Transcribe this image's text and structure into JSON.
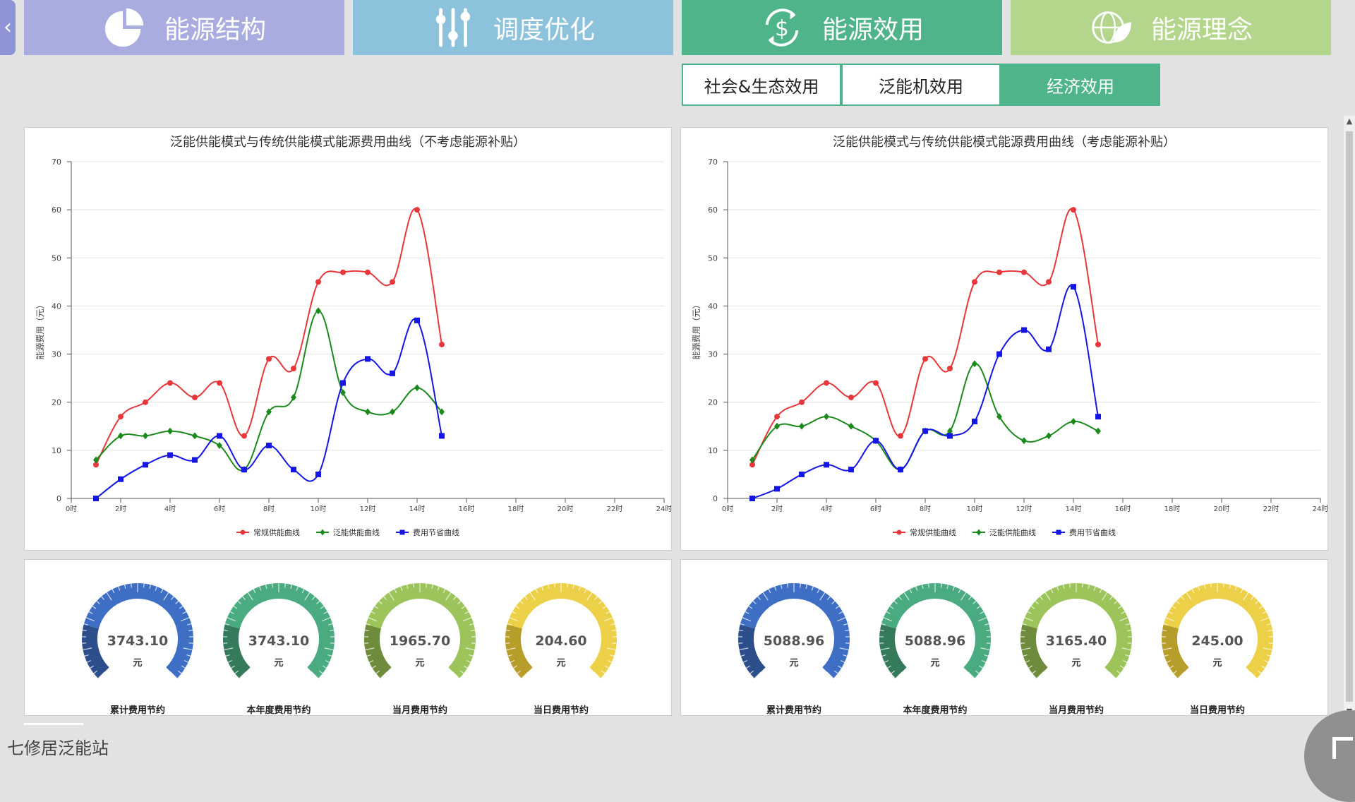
{
  "nav": {
    "back_icon": "chevron-left-icon",
    "tabs": [
      {
        "label": "能源结构",
        "icon": "pie-chart-icon",
        "color": "#a9acdf"
      },
      {
        "label": "调度优化",
        "icon": "sliders-icon",
        "color": "#8cc2db"
      },
      {
        "label": "能源效用",
        "icon": "dollar-cycle-icon",
        "color": "#4fb489",
        "active": true
      },
      {
        "label": "能源理念",
        "icon": "globe-leaf-icon",
        "color": "#b3d68c"
      }
    ]
  },
  "subtabs": [
    {
      "label": "社会&生态效用",
      "active": false
    },
    {
      "label": "泛能机效用",
      "active": false
    },
    {
      "label": "经济效用",
      "active": true
    }
  ],
  "charts": {
    "left_title": "泛能供能模式与传统供能模式能源费用曲线（不考虑能源补贴）",
    "right_title": "泛能供能模式与传统供能模式能源费用曲线（考虑能源补贴）",
    "ylabel": "能源费用（元）",
    "legend": [
      "常规供能曲线",
      "泛能供能曲线",
      "费用节省曲线"
    ]
  },
  "chart_data": [
    {
      "type": "line",
      "title": "泛能供能模式与传统供能模式能源费用曲线（不考虑能源补贴）",
      "ylabel": "能源费用（元）",
      "ylim": [
        0,
        70
      ],
      "yticks": [
        0,
        10,
        20,
        30,
        40,
        50,
        60,
        70
      ],
      "xlim": [
        0,
        24
      ],
      "xticks": [
        "0时",
        "2时",
        "4时",
        "6时",
        "8时",
        "10时",
        "12时",
        "14时",
        "16时",
        "18时",
        "20时",
        "22时",
        "24时"
      ],
      "x": [
        1,
        2,
        3,
        4,
        5,
        6,
        7,
        8,
        9,
        10,
        11,
        12,
        13,
        14,
        15
      ],
      "grid": true,
      "legend_position": "bottom",
      "series": [
        {
          "name": "常规供能曲线",
          "color": "#e8373a",
          "marker": "circle",
          "values": [
            7,
            17,
            20,
            24,
            21,
            24,
            13,
            29,
            27,
            45,
            47,
            47,
            45,
            60,
            32
          ]
        },
        {
          "name": "泛能供能曲线",
          "color": "#1a8a1a",
          "marker": "diamond",
          "values": [
            8,
            13,
            13,
            14,
            13,
            11,
            6,
            18,
            21,
            39,
            22,
            18,
            18,
            23,
            18
          ]
        },
        {
          "name": "费用节省曲线",
          "color": "#1515e6",
          "marker": "square",
          "values": [
            0,
            4,
            7,
            9,
            8,
            13,
            6,
            11,
            6,
            5,
            24,
            29,
            26,
            37,
            13
          ]
        }
      ]
    },
    {
      "type": "line",
      "title": "泛能供能模式与传统供能模式能源费用曲线（考虑能源补贴）",
      "ylabel": "能源费用（元）",
      "ylim": [
        0,
        70
      ],
      "yticks": [
        0,
        10,
        20,
        30,
        40,
        50,
        60,
        70
      ],
      "xlim": [
        0,
        24
      ],
      "xticks": [
        "0时",
        "2时",
        "4时",
        "6时",
        "8时",
        "10时",
        "12时",
        "14时",
        "16时",
        "18时",
        "20时",
        "22时",
        "24时"
      ],
      "x": [
        1,
        2,
        3,
        4,
        5,
        6,
        7,
        8,
        9,
        10,
        11,
        12,
        13,
        14,
        15
      ],
      "grid": true,
      "legend_position": "bottom",
      "series": [
        {
          "name": "常规供能曲线",
          "color": "#e8373a",
          "marker": "circle",
          "values": [
            7,
            17,
            20,
            24,
            21,
            24,
            13,
            29,
            27,
            45,
            47,
            47,
            45,
            60,
            32
          ]
        },
        {
          "name": "泛能供能曲线",
          "color": "#1a8a1a",
          "marker": "diamond",
          "values": [
            8,
            15,
            15,
            17,
            15,
            12,
            6,
            14,
            14,
            28,
            17,
            12,
            13,
            16,
            14
          ]
        },
        {
          "name": "费用节省曲线",
          "color": "#1515e6",
          "marker": "square",
          "values": [
            0,
            2,
            5,
            7,
            6,
            12,
            6,
            14,
            13,
            16,
            30,
            35,
            31,
            44,
            17
          ]
        }
      ]
    }
  ],
  "gauges": {
    "unit": "元",
    "left": [
      {
        "value": "3743.10",
        "label": "累计费用节约",
        "color": "#3e6fc4",
        "dark": "#2c4f8c"
      },
      {
        "value": "3743.10",
        "label": "本年度费用节约",
        "color": "#4aab80",
        "dark": "#357a5b"
      },
      {
        "value": "1965.70",
        "label": "当月费用节约",
        "color": "#9cc45a",
        "dark": "#6f8c3d"
      },
      {
        "value": "204.60",
        "label": "当日费用节约",
        "color": "#ecd048",
        "dark": "#b79d2a"
      }
    ],
    "right": [
      {
        "value": "5088.96",
        "label": "累计费用节约",
        "color": "#3e6fc4",
        "dark": "#2c4f8c"
      },
      {
        "value": "5088.96",
        "label": "本年度费用节约",
        "color": "#4aab80",
        "dark": "#357a5b"
      },
      {
        "value": "3165.40",
        "label": "当月费用节约",
        "color": "#9cc45a",
        "dark": "#6f8c3d"
      },
      {
        "value": "245.00",
        "label": "当日费用节约",
        "color": "#ecd048",
        "dark": "#b79d2a"
      }
    ]
  },
  "footer": {
    "station": "七修居泛能站"
  }
}
